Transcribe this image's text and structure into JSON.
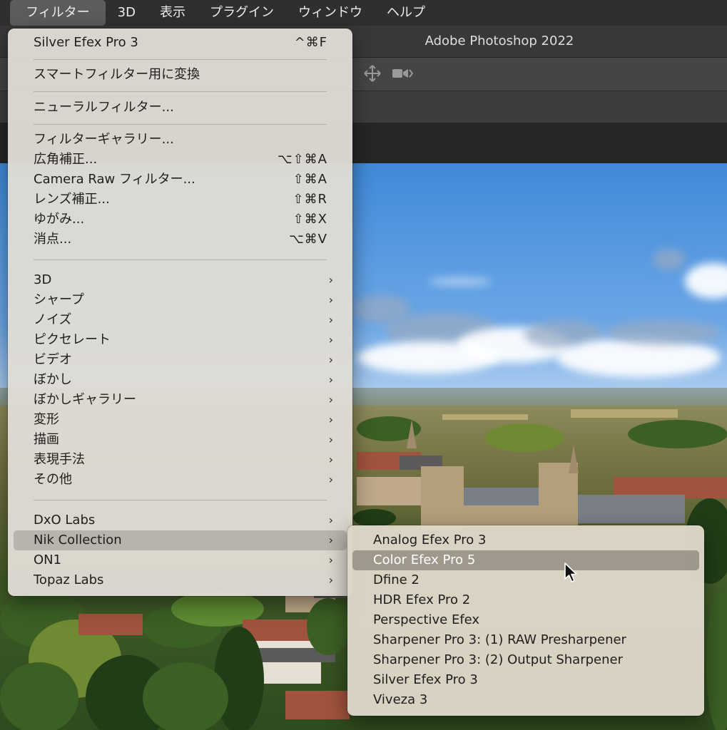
{
  "menubar": {
    "items": [
      "フィルター",
      "3D",
      "表示",
      "プラグイン",
      "ウィンドウ",
      "ヘルプ"
    ],
    "active_index": 0
  },
  "app": {
    "title": "Adobe Photoshop 2022"
  },
  "filter_menu": {
    "items": [
      {
        "label": "Silver Efex Pro 3",
        "shortcut": "^⌘F"
      },
      {
        "label": "スマートフィルター用に変換"
      },
      {
        "label": "ニューラルフィルター..."
      },
      {
        "label": "フィルターギャラリー..."
      },
      {
        "label": "広角補正...",
        "shortcut": "⌥⇧⌘A"
      },
      {
        "label": "Camera Raw フィルター...",
        "shortcut": "⇧⌘A"
      },
      {
        "label": "レンズ補正...",
        "shortcut": "⇧⌘R"
      },
      {
        "label": "ゆがみ...",
        "shortcut": "⇧⌘X"
      },
      {
        "label": "消点...",
        "shortcut": "⌥⌘V"
      },
      {
        "label": "3D",
        "submenu": true
      },
      {
        "label": "シャープ",
        "submenu": true
      },
      {
        "label": "ノイズ",
        "submenu": true
      },
      {
        "label": "ピクセレート",
        "submenu": true
      },
      {
        "label": "ビデオ",
        "submenu": true
      },
      {
        "label": "ぼかし",
        "submenu": true
      },
      {
        "label": "ぼかしギャラリー",
        "submenu": true
      },
      {
        "label": "変形",
        "submenu": true
      },
      {
        "label": "描画",
        "submenu": true
      },
      {
        "label": "表現手法",
        "submenu": true
      },
      {
        "label": "その他",
        "submenu": true
      },
      {
        "label": "DxO Labs",
        "submenu": true
      },
      {
        "label": "Nik Collection",
        "submenu": true,
        "highlighted": true
      },
      {
        "label": "ON1",
        "submenu": true
      },
      {
        "label": "Topaz Labs",
        "submenu": true
      }
    ],
    "submenu_arrow": "›"
  },
  "nik_submenu": {
    "items": [
      {
        "label": "Analog Efex Pro 3"
      },
      {
        "label": "Color Efex Pro 5",
        "highlighted": true
      },
      {
        "label": "Dfine 2"
      },
      {
        "label": "HDR Efex Pro 2"
      },
      {
        "label": "Perspective Efex"
      },
      {
        "label": "Sharpener Pro 3: (1) RAW Presharpener"
      },
      {
        "label": "Sharpener Pro 3: (2) Output Sharpener"
      },
      {
        "label": "Silver Efex Pro 3"
      },
      {
        "label": "Viveza 3"
      }
    ]
  },
  "icons": {
    "options_bar": [
      "move-3d-icon",
      "video-camera-3d-icon"
    ],
    "cursor": "arrow-cursor-icon"
  }
}
